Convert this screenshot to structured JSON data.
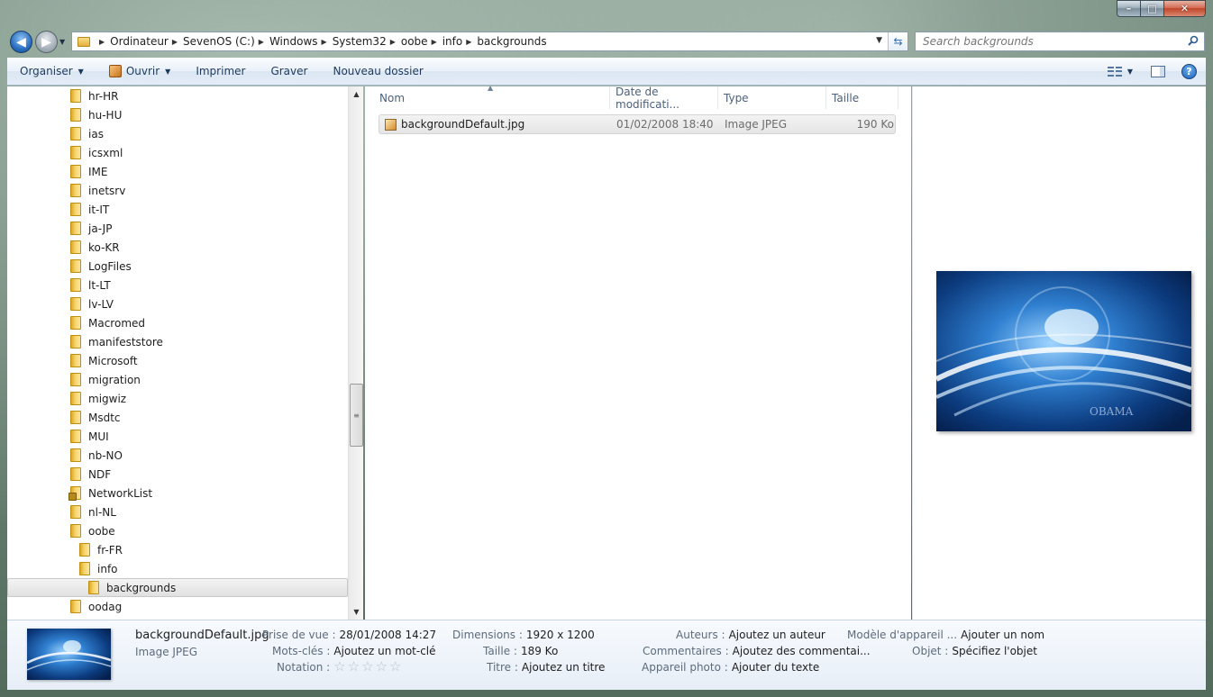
{
  "window": {
    "caption": {
      "minimize": "–",
      "maximize": "□",
      "close": "✕"
    }
  },
  "nav": {
    "back": "◀",
    "forward": "▶"
  },
  "address": {
    "crumbs": [
      "Ordinateur",
      "SevenOS (C:)",
      "Windows",
      "System32",
      "oobe",
      "info",
      "backgrounds"
    ]
  },
  "search": {
    "placeholder": "Search backgrounds"
  },
  "toolbar": {
    "organiser": "Organiser",
    "ouvrir": "Ouvrir",
    "imprimer": "Imprimer",
    "graver": "Graver",
    "nouveau_dossier": "Nouveau dossier"
  },
  "tree": {
    "items": [
      {
        "label": "hr-HR"
      },
      {
        "label": "hu-HU"
      },
      {
        "label": "ias"
      },
      {
        "label": "icsxml"
      },
      {
        "label": "IME"
      },
      {
        "label": "inetsrv"
      },
      {
        "label": "it-IT"
      },
      {
        "label": "ja-JP"
      },
      {
        "label": "ko-KR"
      },
      {
        "label": "LogFiles"
      },
      {
        "label": "lt-LT"
      },
      {
        "label": "lv-LV"
      },
      {
        "label": "Macromed"
      },
      {
        "label": "manifeststore"
      },
      {
        "label": "Microsoft"
      },
      {
        "label": "migration"
      },
      {
        "label": "migwiz"
      },
      {
        "label": "Msdtc"
      },
      {
        "label": "MUI"
      },
      {
        "label": "nb-NO"
      },
      {
        "label": "NDF"
      },
      {
        "label": "NetworkList"
      },
      {
        "label": "nl-NL"
      },
      {
        "label": "oobe"
      },
      {
        "label": "fr-FR"
      },
      {
        "label": "info"
      },
      {
        "label": "backgrounds"
      },
      {
        "label": "oodag"
      }
    ]
  },
  "columns": {
    "name": "Nom",
    "date": "Date de modificati...",
    "type": "Type",
    "size": "Taille"
  },
  "files": [
    {
      "name": "backgroundDefault.jpg",
      "date": "01/02/2008 18:40",
      "type": "Image JPEG",
      "size": "190 Ko"
    }
  ],
  "preview": {
    "watermark": "OBAMA"
  },
  "details": {
    "title": "backgroundDefault.jpg",
    "type": "Image JPEG",
    "prise_de_vue_k": "Prise de vue :",
    "prise_de_vue_v": "28/01/2008 14:27",
    "mots_cles_k": "Mots-clés :",
    "mots_cles_v": "Ajoutez un mot-clé",
    "notation_k": "Notation :",
    "dimensions_k": "Dimensions :",
    "dimensions_v": "1920 x 1200",
    "taille_k": "Taille :",
    "taille_v": "189 Ko",
    "titre_k": "Titre :",
    "titre_v": "Ajoutez un titre",
    "auteurs_k": "Auteurs :",
    "auteurs_v": "Ajoutez un auteur",
    "commentaires_k": "Commentaires :",
    "commentaires_v": "Ajoutez des commentai...",
    "appareil_k": "Appareil photo :",
    "appareil_v": "Ajouter du texte",
    "modele_k": "Modèle d'appareil ...",
    "modele_v": "Ajouter un nom",
    "objet_k": "Objet :",
    "objet_v": "Spécifiez l'objet",
    "rating": 0
  }
}
